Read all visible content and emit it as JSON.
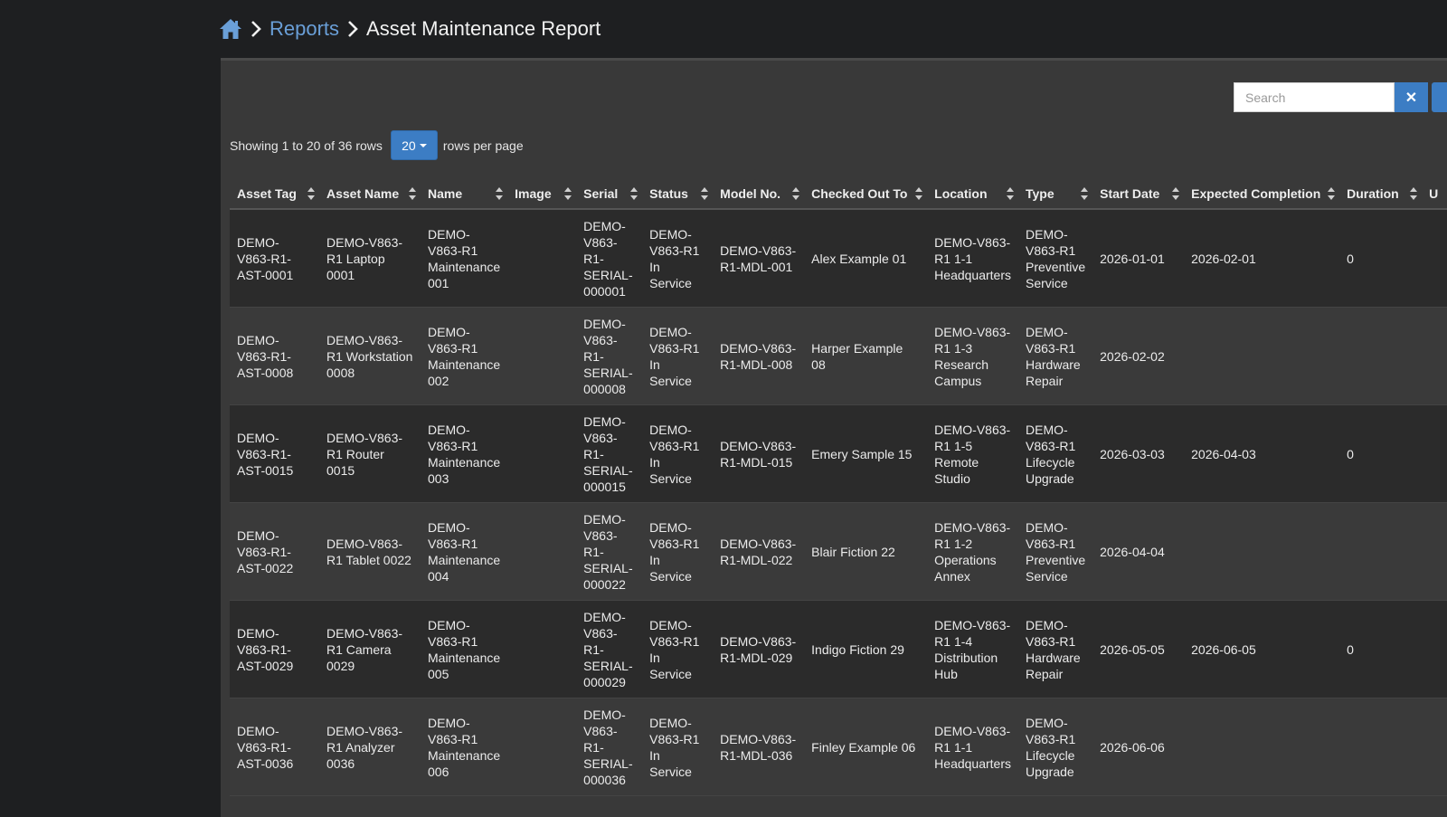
{
  "breadcrumb": {
    "home_icon": "home-icon",
    "reports_label": "Reports",
    "current_label": "Asset Maintenance Report"
  },
  "toolbar": {
    "search_placeholder": "Search",
    "clear_icon": "✕"
  },
  "pagination": {
    "showing_text": "Showing 1 to 20 of 36 rows",
    "page_size": "20",
    "rows_per_page_text": "rows per page"
  },
  "colors": {
    "accent": "#3c7dc4",
    "link": "#6a9fd8",
    "background": "#1e1f21",
    "panel": "#393939"
  },
  "table": {
    "columns": [
      "Asset Tag",
      "Asset Name",
      "Name",
      "Image",
      "Serial",
      "Status",
      "Model No.",
      "Checked Out To",
      "Location",
      "Type",
      "Start Date",
      "Expected Completion",
      "Duration",
      "U"
    ],
    "rows": [
      {
        "asset_tag": "DEMO-V863-R1-AST-0001",
        "asset_name": "DEMO-V863-R1 Laptop 0001",
        "name": "DEMO-V863-R1 Maintenance 001",
        "image": "",
        "serial": "DEMO-V863-R1-SERIAL-000001",
        "status": "DEMO-V863-R1 In Service",
        "model_no": "DEMO-V863-R1-MDL-001",
        "checked_out_to": "Alex Example 01",
        "location": "DEMO-V863-R1 1-1 Headquarters",
        "type": "DEMO-V863-R1 Preventive Service",
        "start_date": "2026-01-01",
        "expected_completion": "2026-02-01",
        "duration": "0"
      },
      {
        "asset_tag": "DEMO-V863-R1-AST-0008",
        "asset_name": "DEMO-V863-R1 Workstation 0008",
        "name": "DEMO-V863-R1 Maintenance 002",
        "image": "",
        "serial": "DEMO-V863-R1-SERIAL-000008",
        "status": "DEMO-V863-R1 In Service",
        "model_no": "DEMO-V863-R1-MDL-008",
        "checked_out_to": "Harper Example 08",
        "location": "DEMO-V863-R1 1-3 Research Campus",
        "type": "DEMO-V863-R1 Hardware Repair",
        "start_date": "2026-02-02",
        "expected_completion": "",
        "duration": ""
      },
      {
        "asset_tag": "DEMO-V863-R1-AST-0015",
        "asset_name": "DEMO-V863-R1 Router 0015",
        "name": "DEMO-V863-R1 Maintenance 003",
        "image": "",
        "serial": "DEMO-V863-R1-SERIAL-000015",
        "status": "DEMO-V863-R1 In Service",
        "model_no": "DEMO-V863-R1-MDL-015",
        "checked_out_to": "Emery Sample 15",
        "location": "DEMO-V863-R1 1-5 Remote Studio",
        "type": "DEMO-V863-R1 Lifecycle Upgrade",
        "start_date": "2026-03-03",
        "expected_completion": "2026-04-03",
        "duration": "0"
      },
      {
        "asset_tag": "DEMO-V863-R1-AST-0022",
        "asset_name": "DEMO-V863-R1 Tablet 0022",
        "name": "DEMO-V863-R1 Maintenance 004",
        "image": "",
        "serial": "DEMO-V863-R1-SERIAL-000022",
        "status": "DEMO-V863-R1 In Service",
        "model_no": "DEMO-V863-R1-MDL-022",
        "checked_out_to": "Blair Fiction 22",
        "location": "DEMO-V863-R1 1-2 Operations Annex",
        "type": "DEMO-V863-R1 Preventive Service",
        "start_date": "2026-04-04",
        "expected_completion": "",
        "duration": ""
      },
      {
        "asset_tag": "DEMO-V863-R1-AST-0029",
        "asset_name": "DEMO-V863-R1 Camera 0029",
        "name": "DEMO-V863-R1 Maintenance 005",
        "image": "",
        "serial": "DEMO-V863-R1-SERIAL-000029",
        "status": "DEMO-V863-R1 In Service",
        "model_no": "DEMO-V863-R1-MDL-029",
        "checked_out_to": "Indigo Fiction 29",
        "location": "DEMO-V863-R1 1-4 Distribution Hub",
        "type": "DEMO-V863-R1 Hardware Repair",
        "start_date": "2026-05-05",
        "expected_completion": "2026-06-05",
        "duration": "0"
      },
      {
        "asset_tag": "DEMO-V863-R1-AST-0036",
        "asset_name": "DEMO-V863-R1 Analyzer 0036",
        "name": "DEMO-V863-R1 Maintenance 006",
        "image": "",
        "serial": "DEMO-V863-R1-SERIAL-000036",
        "status": "DEMO-V863-R1 In Service",
        "model_no": "DEMO-V863-R1-MDL-036",
        "checked_out_to": "Finley Example 06",
        "location": "DEMO-V863-R1 1-1 Headquarters",
        "type": "DEMO-V863-R1 Lifecycle Upgrade",
        "start_date": "2026-06-06",
        "expected_completion": "",
        "duration": ""
      }
    ]
  }
}
